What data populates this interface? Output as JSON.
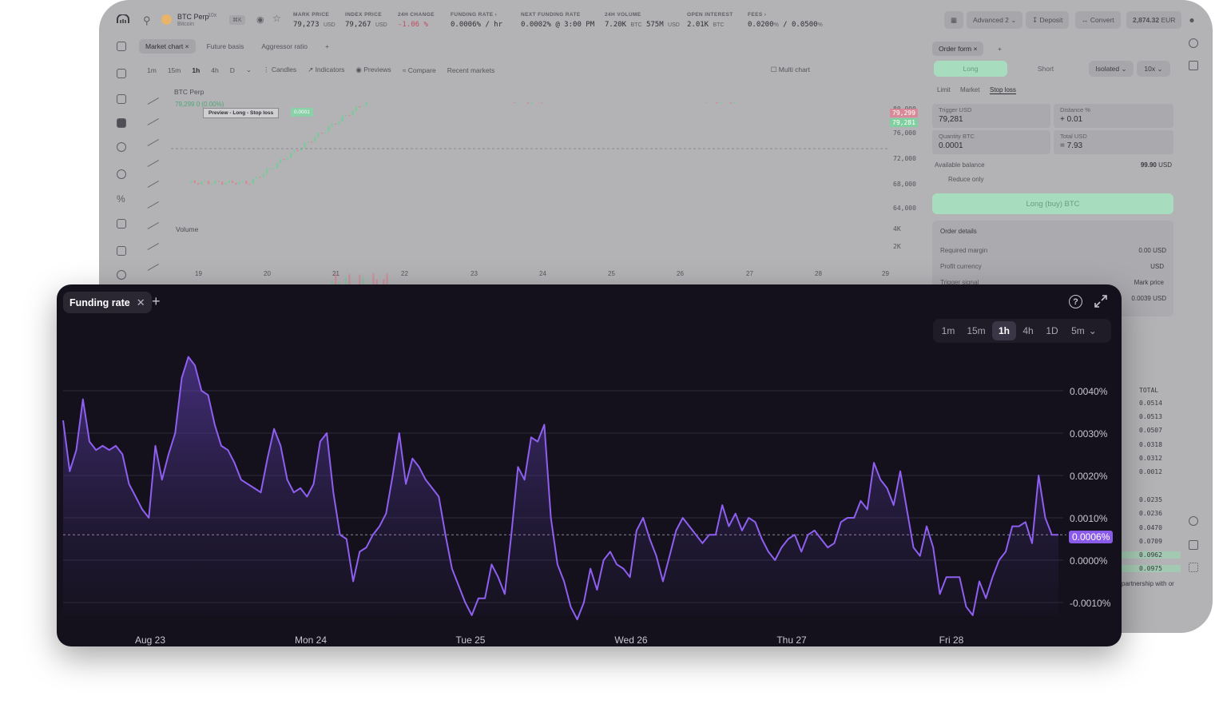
{
  "app": {
    "coin": {
      "name": "BTC Perp",
      "sub": "Bitcoin",
      "leverage": "10x",
      "shortcut": "⌘K"
    },
    "stats": [
      {
        "label": "MARK PRICE",
        "value": "79,273",
        "unit": "USD"
      },
      {
        "label": "INDEX PRICE",
        "value": "79,267",
        "unit": "USD"
      },
      {
        "label": "24H CHANGE",
        "value": "-1.06",
        "unit": "%",
        "negative": true
      },
      {
        "label": "FUNDING RATE",
        "value": "0.0006% / hr",
        "unit": ""
      },
      {
        "label": "NEXT FUNDING RATE",
        "value": "0.0002% @ 3:00 PM",
        "unit": ""
      },
      {
        "label": "24H VOLUME",
        "value": "7.20K",
        "unit": "BTC",
        "value2": "575M",
        "unit2": "USD"
      },
      {
        "label": "OPEN INTEREST",
        "value": "2.01K",
        "unit": "BTC"
      },
      {
        "label": "FEES",
        "value": "0.0200",
        "unit": "%",
        "value2": "0.0500",
        "unit2": "%"
      }
    ],
    "toolbar": {
      "layout": "Advanced 2",
      "deposit": "Deposit",
      "convert": "Convert",
      "balance": "2,874.32",
      "currency": "EUR"
    },
    "chart": {
      "tabs": [
        "Market chart",
        "Future basis",
        "Aggressor ratio"
      ],
      "timeframes": [
        "1m",
        "15m",
        "1h",
        "4h",
        "D"
      ],
      "tools": [
        "Candles",
        "Indicators",
        "Previews",
        "Compare",
        "Recent markets"
      ],
      "multi_chart": "Multi chart",
      "symbol": "BTC Perp",
      "price_line": "79,299",
      "price_change": "0 (0.00%)",
      "preview_label": "Preview - Long - Stop loss",
      "preview_value": "0.0001",
      "price_axis": [
        "80,000",
        "76,000",
        "72,000",
        "68,000",
        "64,000"
      ],
      "price_tag_red": "79,299",
      "price_tag_green": "79,281",
      "volume_label": "Volume",
      "volume_axis": [
        "4K",
        "2K"
      ],
      "dates": [
        "19",
        "20",
        "21",
        "22",
        "23",
        "24",
        "25",
        "26",
        "27",
        "28",
        "29"
      ]
    },
    "order": {
      "tab": "Order form",
      "long": "Long",
      "short": "Short",
      "margin": "Isolated",
      "leverage": "10x",
      "types": [
        "Limit",
        "Market",
        "Stop loss"
      ],
      "trigger_label": "Trigger USD",
      "trigger_value": "79,281",
      "distance_label": "Distance %",
      "distance_value": "+ 0.01",
      "quantity_label": "Quantity BTC",
      "quantity_value": "0.0001",
      "total_label": "Total USD",
      "total_value": "= 7.93",
      "available_label": "Available balance",
      "available_value": "99.90",
      "available_unit": "USD",
      "reduce_only": "Reduce only",
      "submit": "Long (buy) BTC",
      "details_title": "Order details",
      "details": [
        {
          "label": "Required margin",
          "value": "0.00 USD"
        },
        {
          "label": "Profit currency",
          "value": "USD"
        },
        {
          "label": "Trigger signal",
          "value": "Mark price"
        },
        {
          "label": "",
          "value": "0.0039 USD"
        }
      ]
    },
    "orderbook": {
      "header": "TOTAL",
      "values": [
        "0.0514",
        "0.0513",
        "0.0507",
        "0.0318",
        "0.0312",
        "0.0012",
        "0.0235",
        "0.0236",
        "0.0470",
        "0.0709",
        "0.0962",
        "0.0975"
      ],
      "footer": "partnership with or"
    }
  },
  "funding": {
    "tab_label": "Funding rate",
    "timeframes": [
      "1m",
      "15m",
      "1h",
      "4h",
      "1D"
    ],
    "active_timeframe": "1h",
    "interval": "5m",
    "current_label": "0.0006%",
    "colors": {
      "line": "#8e5ff0",
      "badge": "#8a5ae8",
      "background": "#14111c"
    }
  },
  "chart_data": {
    "type": "area",
    "title": "",
    "y_ticks": [
      "0.0040%",
      "0.0030%",
      "0.0020%",
      "0.0010%",
      "0.0000%",
      "-0.0010%"
    ],
    "ylim": [
      -0.0013,
      0.0046
    ],
    "x_labels": [
      "Aug 23",
      "Mon 24",
      "Tue 25",
      "Wed 26",
      "Thu 27",
      "Fri 28"
    ],
    "current_value": 0.0006,
    "series": [
      {
        "values": [
          0.0033,
          0.0021,
          0.0026,
          0.0038,
          0.0028,
          0.0026,
          0.0027,
          0.0026,
          0.0027,
          0.0025,
          0.0018,
          0.0015,
          0.0012,
          0.001,
          0.0027,
          0.0019,
          0.0025,
          0.003,
          0.0043,
          0.0048,
          0.0046,
          0.004,
          0.0039,
          0.0032,
          0.0027,
          0.0026,
          0.0023,
          0.0019,
          0.0018,
          0.0017,
          0.0016,
          0.0024,
          0.0031,
          0.0027,
          0.0019,
          0.0016,
          0.0017,
          0.0015,
          0.0018,
          0.0028,
          0.003,
          0.0016,
          0.0006,
          0.0005,
          -0.0005,
          0.0002,
          0.0003,
          0.0006,
          0.0008,
          0.0011,
          0.002,
          0.003,
          0.0018,
          0.0024,
          0.0022,
          0.0019,
          0.0017,
          0.0015,
          0.0006,
          -0.0002,
          -0.0006,
          -0.001,
          -0.0013,
          -0.0009,
          -0.0009,
          -0.0001,
          -0.0004,
          -0.0008,
          0.0006,
          0.0022,
          0.0019,
          0.0029,
          0.0028,
          0.0032,
          0.001,
          -0.0001,
          -0.0005,
          -0.0011,
          -0.0014,
          -0.001,
          -0.0002,
          -0.0007,
          0.0,
          0.0002,
          -0.0001,
          -0.0002,
          -0.0004,
          0.0007,
          0.001,
          0.0005,
          0.0001,
          -0.0005,
          0.0001,
          0.0007,
          0.001,
          0.0008,
          0.0006,
          0.0004,
          0.0006,
          0.0006,
          0.0013,
          0.0008,
          0.0011,
          0.0007,
          0.001,
          0.0009,
          0.0005,
          0.0002,
          0.0,
          0.0003,
          0.0005,
          0.0006,
          0.0002,
          0.0006,
          0.0007,
          0.0005,
          0.0003,
          0.0004,
          0.0009,
          0.001,
          0.001,
          0.0014,
          0.0012,
          0.0023,
          0.0019,
          0.0017,
          0.0013,
          0.0021,
          0.0012,
          0.0003,
          0.0001,
          0.0008,
          0.0003,
          -0.0008,
          -0.0004,
          -0.0004,
          -0.0004,
          -0.0011,
          -0.0013,
          -0.0005,
          -0.0009,
          -0.0004,
          0.0,
          0.0002,
          0.0008,
          0.0008,
          0.0009,
          0.0004,
          0.002,
          0.001,
          0.0006,
          0.0006
        ]
      }
    ]
  }
}
